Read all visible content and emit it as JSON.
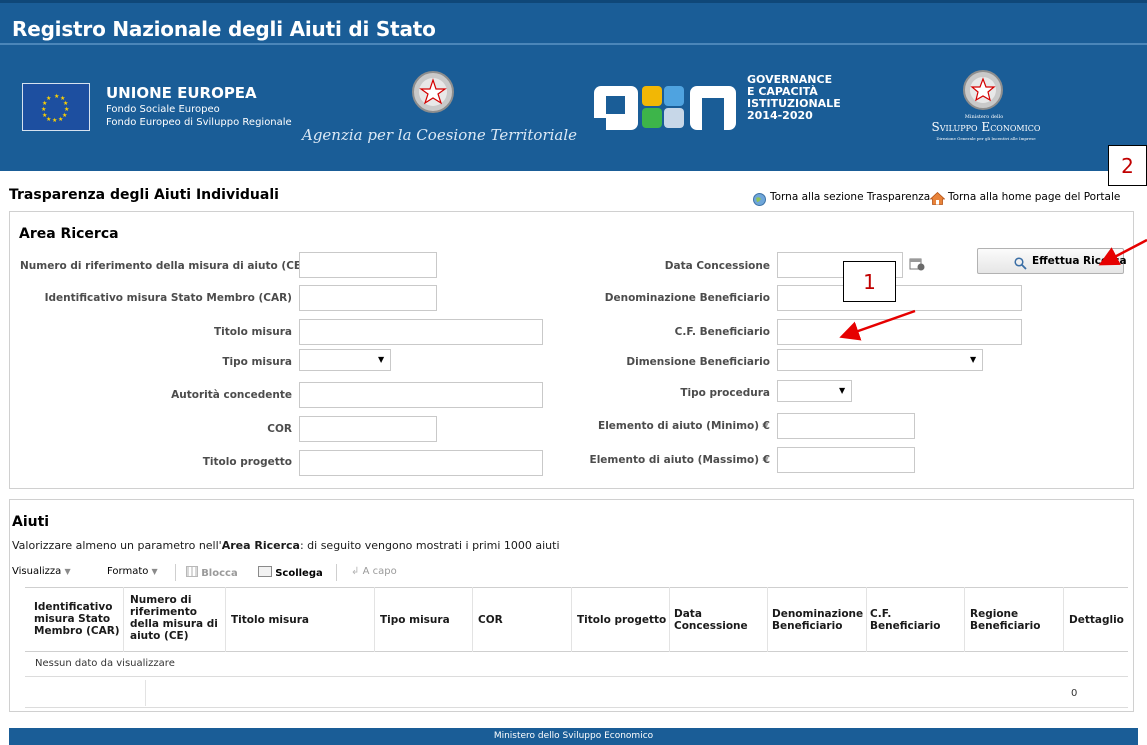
{
  "header": {
    "site_title": "Registro Nazionale degli Aiuti di Stato",
    "eu_title": "UNIONE EUROPEA",
    "eu_line1": "Fondo Sociale Europeo",
    "eu_line2": "Fondo Europeo di Sviluppo Regionale",
    "agency": "Agenzia per la Coesione Territoriale",
    "gov_line1": "GOVERNANCE",
    "gov_line2": "E CAPACITÀ",
    "gov_line3": "ISTITUZIONALE",
    "gov_line4": "2014-2020",
    "mise_small": "Ministero dello",
    "mise_big": "Sviluppo Economico",
    "mise_sub": "Direzione Generale per gli Incentivi alle Imprese",
    "colors": {
      "header_bg": "#1a5d97",
      "accent_red": "#e60000"
    }
  },
  "page": {
    "title": "Trasparenza degli Aiuti Individuali",
    "link_trasparenza": "Torna alla sezione Trasparenza",
    "link_home": "Torna alla home page del Portale"
  },
  "search": {
    "title": "Area Ricerca",
    "button_label": "Effettua Ricerca",
    "left_fields": [
      {
        "label": "Numero di riferimento della misura di aiuto (CE)",
        "value": ""
      },
      {
        "label": "Identificativo misura Stato Membro (CAR)",
        "value": ""
      },
      {
        "label": "Titolo misura",
        "value": ""
      },
      {
        "label": "Tipo misura",
        "value": ""
      },
      {
        "label": "Autorità concedente",
        "value": ""
      },
      {
        "label": "COR",
        "value": ""
      },
      {
        "label": "Titolo progetto",
        "value": ""
      }
    ],
    "right_fields": [
      {
        "label": "Data Concessione",
        "value": ""
      },
      {
        "label": "Denominazione Beneficiario",
        "value": ""
      },
      {
        "label": "C.F. Beneficiario",
        "value": ""
      },
      {
        "label": "Dimensione Beneficiario",
        "value": ""
      },
      {
        "label": "Tipo procedura",
        "value": ""
      },
      {
        "label": "Elemento di aiuto (Minimo) €",
        "value": ""
      },
      {
        "label": "Elemento di aiuto (Massimo) €",
        "value": ""
      }
    ]
  },
  "results": {
    "title": "Aiuti",
    "hint_pre": "Valorizzare almeno un parametro nell'",
    "hint_bold": "Area Ricerca",
    "hint_post": ": di seguito vengono mostrati i primi 1000 aiuti",
    "toolbar": {
      "visualizza": "Visualizza",
      "formato": "Formato",
      "blocca": "Blocca",
      "scollega": "Scollega",
      "a_capo": "A capo"
    },
    "columns": [
      "Identificativo misura Stato Membro (CAR)",
      "Numero di riferimento della misura di aiuto (CE)",
      "Titolo misura",
      "Tipo misura",
      "COR",
      "Titolo progetto",
      "Data Concessione",
      "Denominazione Beneficiario",
      "C.F. Beneficiario",
      "Regione Beneficiario",
      "Dettaglio"
    ],
    "empty_message": "Nessun dato da visualizzare",
    "total_count": "0"
  },
  "footer": {
    "text": "Ministero dello Sviluppo Economico"
  },
  "annotations": {
    "marker_1": "1",
    "marker_2": "2"
  }
}
